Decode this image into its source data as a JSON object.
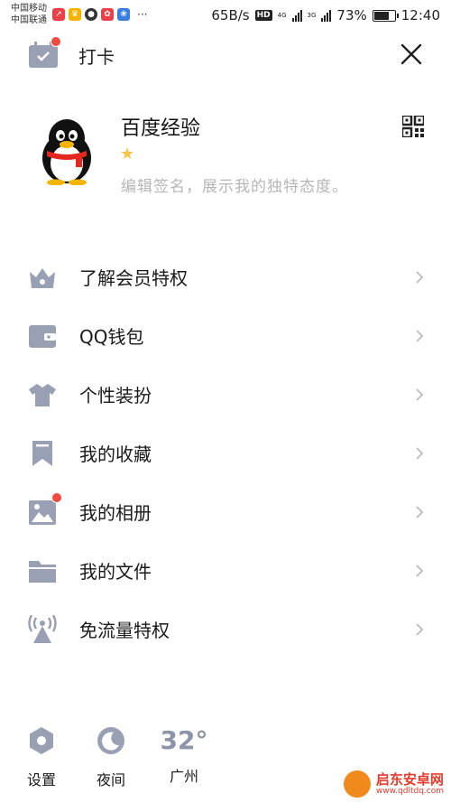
{
  "status_bar": {
    "carrier1": "中国移动",
    "carrier2": "中国联通",
    "more": "···",
    "speed": "65B/s",
    "hd": "HD",
    "net1": "4G",
    "net2": "3G",
    "battery": "73%",
    "battery_level": 0.73,
    "time": "12:40"
  },
  "header": {
    "checkin_label": "打卡"
  },
  "profile": {
    "username": "百度经验",
    "star": "★",
    "signature": "编辑签名，展示我的独特态度。"
  },
  "menu": {
    "items": [
      {
        "label": "了解会员特权",
        "icon": "vip-crown-icon"
      },
      {
        "label": "QQ钱包",
        "icon": "wallet-icon"
      },
      {
        "label": "个性装扮",
        "icon": "shirt-icon"
      },
      {
        "label": "我的收藏",
        "icon": "bookmark-icon"
      },
      {
        "label": "我的相册",
        "icon": "photo-icon"
      },
      {
        "label": "我的文件",
        "icon": "folder-icon"
      },
      {
        "label": "免流量特权",
        "icon": "antenna-icon"
      }
    ]
  },
  "bottom": {
    "settings_label": "设置",
    "night_label": "夜间",
    "temperature": "32°",
    "city": "广州"
  },
  "watermark": {
    "name": "启东安卓网",
    "url": "www.qdltdq.com"
  },
  "colors": {
    "icon": "#9aa0b4",
    "red_dot": "#f04b3e",
    "signature": "#b6b6b6"
  }
}
